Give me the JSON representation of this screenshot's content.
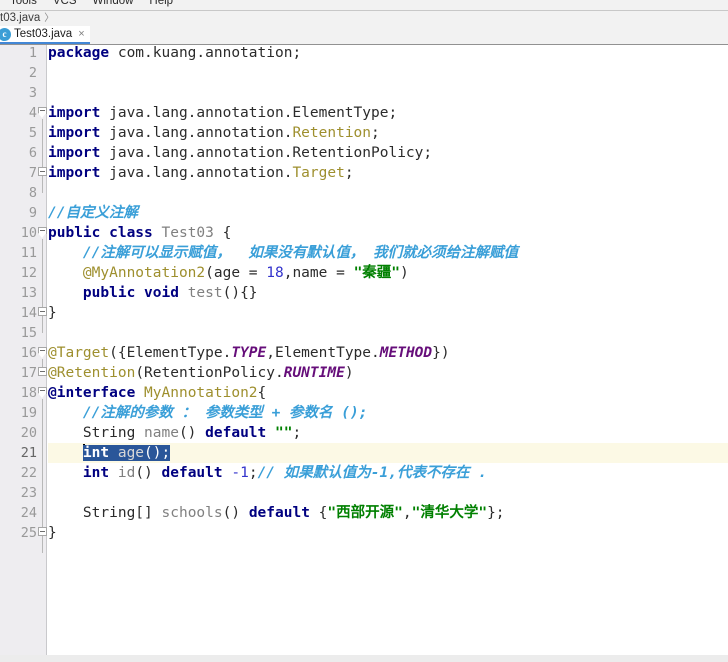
{
  "menu": {
    "items": [
      "Tools",
      "VCS",
      "Window",
      "Help"
    ]
  },
  "breadcrumb": {
    "file": "t03.java",
    "separator": "〉"
  },
  "tab": {
    "label": "Test03.java",
    "icon": "java-class-icon",
    "icon_letter": "c",
    "close": "×"
  },
  "editor": {
    "selected_line": 21,
    "lines": [
      {
        "n": "1",
        "tokens": [
          {
            "t": "package ",
            "c": "kw"
          },
          {
            "t": "com.kuang.annotation;",
            "c": "plain"
          }
        ]
      },
      {
        "n": "2",
        "tokens": []
      },
      {
        "n": "3",
        "tokens": []
      },
      {
        "n": "4",
        "tokens": [
          {
            "t": "import ",
            "c": "kw"
          },
          {
            "t": "java.lang.annotation.ElementType;",
            "c": "plain"
          }
        ]
      },
      {
        "n": "5",
        "tokens": [
          {
            "t": "import ",
            "c": "kw"
          },
          {
            "t": "java.lang.annotation.",
            "c": "plain"
          },
          {
            "t": "Retention",
            "c": "anno"
          },
          {
            "t": ";",
            "c": "plain"
          }
        ]
      },
      {
        "n": "6",
        "tokens": [
          {
            "t": "import ",
            "c": "kw"
          },
          {
            "t": "java.lang.annotation.RetentionPolicy;",
            "c": "plain"
          }
        ]
      },
      {
        "n": "7",
        "tokens": [
          {
            "t": "import ",
            "c": "kw"
          },
          {
            "t": "java.lang.annotation.",
            "c": "plain"
          },
          {
            "t": "Target",
            "c": "anno"
          },
          {
            "t": ";",
            "c": "plain"
          }
        ]
      },
      {
        "n": "8",
        "tokens": []
      },
      {
        "n": "9",
        "tokens": [
          {
            "t": "//自定义注解",
            "c": "cmt"
          }
        ]
      },
      {
        "n": "10",
        "tokens": [
          {
            "t": "public class ",
            "c": "kw"
          },
          {
            "t": "Test03",
            "c": "cls"
          },
          {
            "t": " {",
            "c": "plain"
          }
        ]
      },
      {
        "n": "11",
        "tokens": [
          {
            "t": "    //注解可以显示赋值，  如果没有默认值， 我们就必须给注解赋值",
            "c": "cmt"
          }
        ]
      },
      {
        "n": "12",
        "tokens": [
          {
            "t": "    ",
            "c": "plain"
          },
          {
            "t": "@MyAnnotation2",
            "c": "anno"
          },
          {
            "t": "(age = ",
            "c": "plain"
          },
          {
            "t": "18",
            "c": "num"
          },
          {
            "t": ",name = ",
            "c": "plain"
          },
          {
            "t": "\"秦疆\"",
            "c": "str"
          },
          {
            "t": ")",
            "c": "plain"
          }
        ]
      },
      {
        "n": "13",
        "tokens": [
          {
            "t": "    public void ",
            "c": "kw"
          },
          {
            "t": "test",
            "c": "ident"
          },
          {
            "t": "(){}",
            "c": "plain"
          }
        ]
      },
      {
        "n": "14",
        "tokens": [
          {
            "t": "}",
            "c": "plain"
          }
        ]
      },
      {
        "n": "15",
        "tokens": []
      },
      {
        "n": "16",
        "tokens": [
          {
            "t": "@Target",
            "c": "anno"
          },
          {
            "t": "({ElementType.",
            "c": "plain"
          },
          {
            "t": "TYPE",
            "c": "enumc"
          },
          {
            "t": ",ElementType.",
            "c": "plain"
          },
          {
            "t": "METHOD",
            "c": "enumc"
          },
          {
            "t": "})",
            "c": "plain"
          }
        ]
      },
      {
        "n": "17",
        "tokens": [
          {
            "t": "@Retention",
            "c": "anno"
          },
          {
            "t": "(RetentionPolicy.",
            "c": "plain"
          },
          {
            "t": "RUNTIME",
            "c": "enumc"
          },
          {
            "t": ")",
            "c": "plain"
          }
        ]
      },
      {
        "n": "18",
        "tokens": [
          {
            "t": "@interface",
            "c": "kw"
          },
          {
            "t": " ",
            "c": "plain"
          },
          {
            "t": "MyAnnotation2",
            "c": "anno"
          },
          {
            "t": "{",
            "c": "plain"
          }
        ]
      },
      {
        "n": "19",
        "tokens": [
          {
            "t": "    //注解的参数 ： 参数类型 + 参数名 ();",
            "c": "cmt"
          }
        ]
      },
      {
        "n": "20",
        "tokens": [
          {
            "t": "    String ",
            "c": "plain"
          },
          {
            "t": "name",
            "c": "ident"
          },
          {
            "t": "() ",
            "c": "plain"
          },
          {
            "t": "default ",
            "c": "kw"
          },
          {
            "t": "\"\"",
            "c": "str"
          },
          {
            "t": ";",
            "c": "plain"
          }
        ]
      },
      {
        "n": "21",
        "tokens": [
          {
            "t": "    ",
            "c": "plain"
          },
          {
            "t": "int ",
            "c": "kw",
            "sel": true
          },
          {
            "t": "age",
            "c": "ident",
            "sel": true
          },
          {
            "t": "();",
            "c": "plain",
            "sel": true
          }
        ]
      },
      {
        "n": "22",
        "tokens": [
          {
            "t": "    ",
            "c": "plain"
          },
          {
            "t": "int ",
            "c": "kw"
          },
          {
            "t": "id",
            "c": "ident"
          },
          {
            "t": "() ",
            "c": "plain"
          },
          {
            "t": "default ",
            "c": "kw"
          },
          {
            "t": "-1",
            "c": "num"
          },
          {
            "t": ";",
            "c": "plain"
          },
          {
            "t": "// 如果默认值为-1,代表不存在 .",
            "c": "cmt"
          }
        ]
      },
      {
        "n": "23",
        "tokens": []
      },
      {
        "n": "24",
        "tokens": [
          {
            "t": "    String[] ",
            "c": "plain"
          },
          {
            "t": "schools",
            "c": "ident"
          },
          {
            "t": "() ",
            "c": "plain"
          },
          {
            "t": "default ",
            "c": "kw"
          },
          {
            "t": "{",
            "c": "plain"
          },
          {
            "t": "\"西部开源\"",
            "c": "str"
          },
          {
            "t": ",",
            "c": "plain"
          },
          {
            "t": "\"清华大学\"",
            "c": "str"
          },
          {
            "t": "};",
            "c": "plain"
          }
        ]
      },
      {
        "n": "25",
        "tokens": [
          {
            "t": "}",
            "c": "plain"
          }
        ]
      }
    ],
    "folds": [
      {
        "line": 4,
        "type": "arrow",
        "span": 4
      },
      {
        "line": 7,
        "type": "box",
        "span": 0
      },
      {
        "line": 10,
        "type": "arrow",
        "span": 5
      },
      {
        "line": 14,
        "type": "box",
        "span": 0
      },
      {
        "line": 16,
        "type": "arrow",
        "span": 1
      },
      {
        "line": 17,
        "type": "box",
        "span": 0
      },
      {
        "line": 18,
        "type": "arrow",
        "span": 8
      },
      {
        "line": 25,
        "type": "box",
        "span": 0
      }
    ]
  },
  "colors": {
    "keyword": "#000080",
    "comment": "#3a9fd8",
    "string": "#008000",
    "number": "#3333cc",
    "annotation": "#9e8f2e",
    "enum_constant": "#660e7a",
    "selection": "#2a5699",
    "current_line": "#fcf9e5",
    "gutter": "#eeedf0",
    "tab_underline": "#4287d6"
  }
}
